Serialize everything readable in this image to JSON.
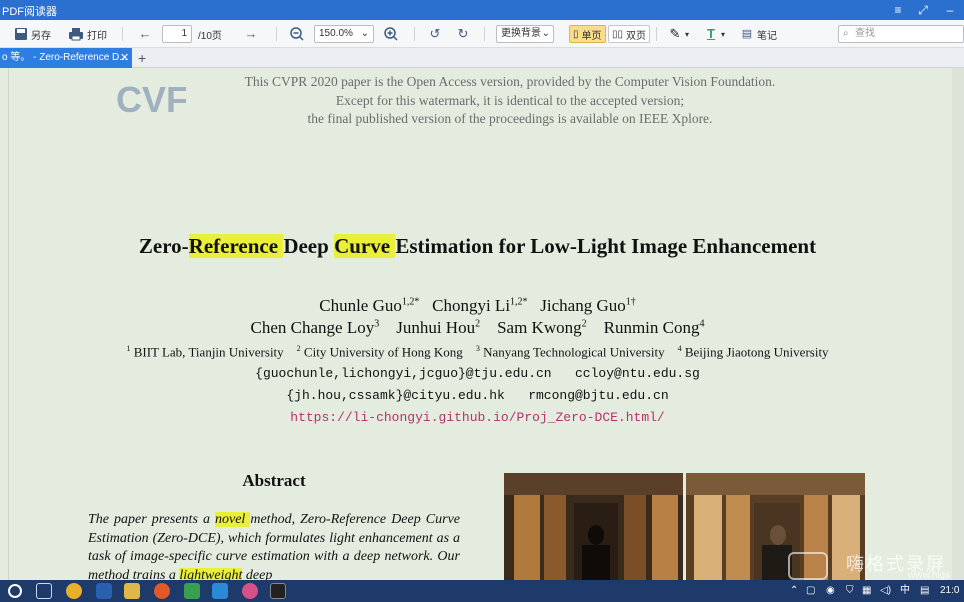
{
  "window": {
    "title": "PDF阅读器",
    "min": "–",
    "max": "✕",
    "menu": "≡",
    "restore": "⤢"
  },
  "toolbar": {
    "save_as": "另存",
    "print": "打印",
    "page_current": "1",
    "page_total": "/10页",
    "zoom": "150.0%",
    "background": "更换背景",
    "single_page": "单页",
    "double_page": "双页",
    "notes": "笔记",
    "search_placeholder": "查找"
  },
  "tabs": [
    {
      "label": "o 等。 - Zero-Reference D..."
    }
  ],
  "tab_close": "✕",
  "tab_add": "+",
  "paper": {
    "watermark_lines": [
      "This CVPR 2020 paper is the Open Access version, provided by the Computer Vision Foundation.",
      "Except for this watermark, it is identical to the accepted version;",
      "the final published version of the proceedings is available on IEEE Xplore."
    ],
    "logo_text": "CVF",
    "title_parts": [
      "Zero-",
      "Reference ",
      "Deep ",
      "Curve ",
      "Estimation for Low-Light Image Enhancement"
    ],
    "authors_line1": [
      {
        "name": "Chunle Guo",
        "sup": "1,2*"
      },
      {
        "name": "Chongyi Li",
        "sup": "1,2*"
      },
      {
        "name": "Jichang Guo",
        "sup": "1†"
      }
    ],
    "authors_line2": [
      {
        "name": "Chen Change Loy",
        "sup": "3"
      },
      {
        "name": "Junhui Hou",
        "sup": "2"
      },
      {
        "name": "Sam Kwong",
        "sup": "2"
      },
      {
        "name": "Runmin Cong",
        "sup": "4"
      }
    ],
    "affiliations": [
      {
        "sup": "1",
        "name": "BIIT Lab, Tianjin University"
      },
      {
        "sup": "2",
        "name": "City University of Hong Kong"
      },
      {
        "sup": "3",
        "name": "Nanyang Technological University"
      },
      {
        "sup": "4",
        "name": "Beijing Jiaotong University"
      }
    ],
    "email_line1": "{guochunle,lichongyi,jcguo}@tju.edu.cn   ccloy@ntu.edu.sg",
    "email_line2": "{jh.hou,cssamk}@cityu.edu.hk   rmcong@bjtu.edu.cn",
    "project_url": "https://li-chongyi.github.io/Proj_Zero-DCE.html/",
    "abstract_heading": "Abstract",
    "abstract_parts": [
      "The paper presents a ",
      "novel ",
      "method, Zero-Reference Deep Curve Estimation (Zero-DCE), which formulates light enhancement as a task of image-specific curve estimation with a deep network. Our method trains a ",
      "lightweight",
      " deep"
    ]
  },
  "overlay_watermark": "嗨格式录屏",
  "overlay_watermark_url": "www.higs",
  "taskbar": {
    "ime": "中",
    "clock": "21:0"
  },
  "colors": {
    "titlebar": "#2b6fcf",
    "tab_active": "#2e7de1",
    "highlight": "#eaf03a",
    "link": "#b2336e",
    "page_bg": "#e4ece0"
  }
}
